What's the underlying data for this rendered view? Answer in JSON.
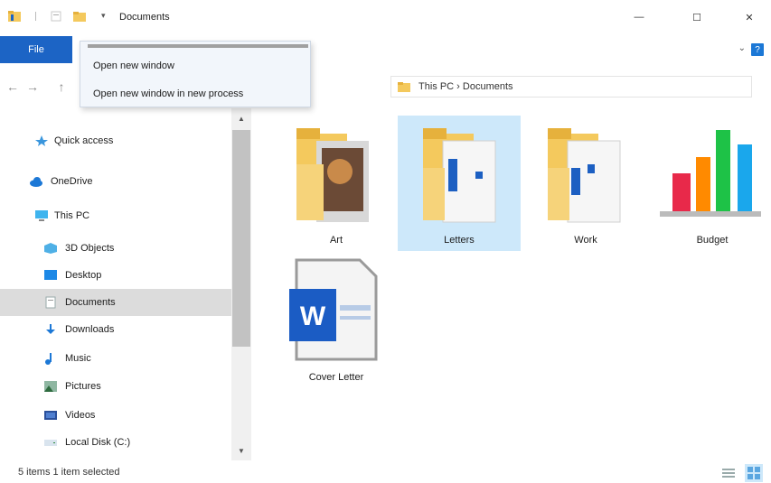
{
  "titlebar": {
    "title": "Documents",
    "minimize": "—",
    "maximize": "☐",
    "close": "✕"
  },
  "ribbon": {
    "file_tab": "File",
    "help": "?",
    "collapse": "⌄"
  },
  "menu": {
    "items": [
      "Open new window",
      "Open new window in new process"
    ]
  },
  "nav": {
    "back": "←",
    "forward": "→",
    "up": "↑",
    "address": "This PC › Documents"
  },
  "sidebar": {
    "items": [
      {
        "label": "Quick access",
        "icon": "star-icon"
      },
      {
        "label": "OneDrive",
        "icon": "cloud-icon"
      },
      {
        "label": "This PC",
        "icon": "computer-icon"
      },
      {
        "label": "3D Objects",
        "icon": "cube-icon"
      },
      {
        "label": "Desktop",
        "icon": "desktop-icon"
      },
      {
        "label": "Documents",
        "icon": "documents-icon"
      },
      {
        "label": "Downloads",
        "icon": "download-icon"
      },
      {
        "label": "Music",
        "icon": "music-icon"
      },
      {
        "label": "Pictures",
        "icon": "pictures-icon"
      },
      {
        "label": "Videos",
        "icon": "videos-icon"
      },
      {
        "label": "Local Disk (C:)",
        "icon": "drive-icon"
      }
    ]
  },
  "content": {
    "items": [
      {
        "label": "Art",
        "type": "folder"
      },
      {
        "label": "Letters",
        "type": "folder"
      },
      {
        "label": "Work",
        "type": "folder"
      },
      {
        "label": "Budget",
        "type": "chart-file"
      },
      {
        "label": "Cover Letter",
        "type": "word-file"
      }
    ]
  },
  "status": {
    "text": "5 items   1 item selected"
  },
  "colors": {
    "accent": "#1c64c5",
    "selection": "#cde8fa",
    "sidebar_selected": "#dcdcdc"
  }
}
